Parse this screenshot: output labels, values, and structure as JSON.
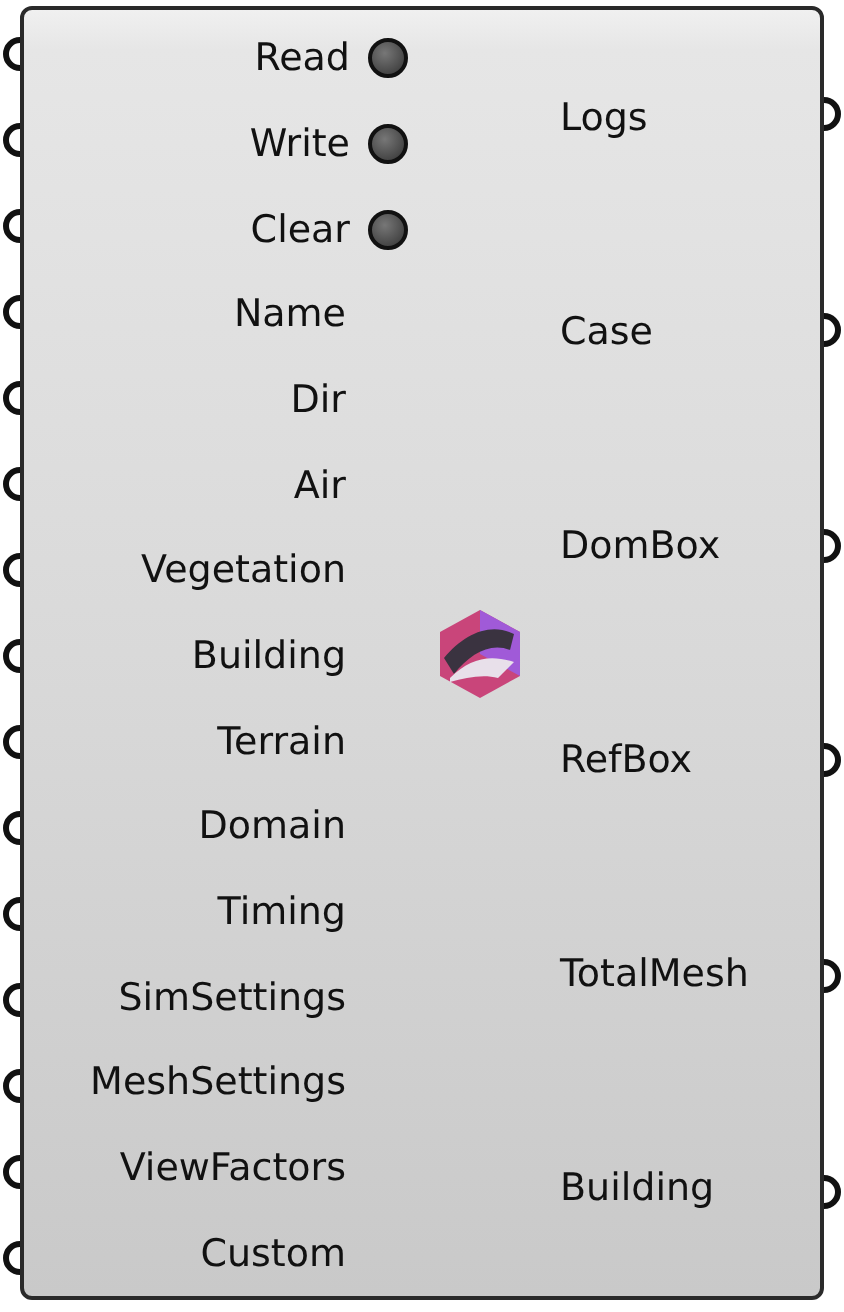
{
  "inputs": [
    {
      "label": "Read",
      "kind": "button"
    },
    {
      "label": "Write",
      "kind": "button"
    },
    {
      "label": "Clear",
      "kind": "button"
    },
    {
      "label": "Name",
      "kind": "plain"
    },
    {
      "label": "Dir",
      "kind": "plain"
    },
    {
      "label": "Air",
      "kind": "plain"
    },
    {
      "label": "Vegetation",
      "kind": "plain"
    },
    {
      "label": "Building",
      "kind": "plain"
    },
    {
      "label": "Terrain",
      "kind": "plain"
    },
    {
      "label": "Domain",
      "kind": "plain"
    },
    {
      "label": "Timing",
      "kind": "plain"
    },
    {
      "label": "SimSettings",
      "kind": "plain"
    },
    {
      "label": "MeshSettings",
      "kind": "plain"
    },
    {
      "label": "ViewFactors",
      "kind": "plain"
    },
    {
      "label": "Custom",
      "kind": "plain"
    }
  ],
  "outputs": [
    {
      "label": "Logs"
    },
    {
      "label": "Case"
    },
    {
      "label": "DomBox"
    },
    {
      "label": "RefBox"
    },
    {
      "label": "TotalMesh"
    },
    {
      "label": "Building"
    }
  ]
}
